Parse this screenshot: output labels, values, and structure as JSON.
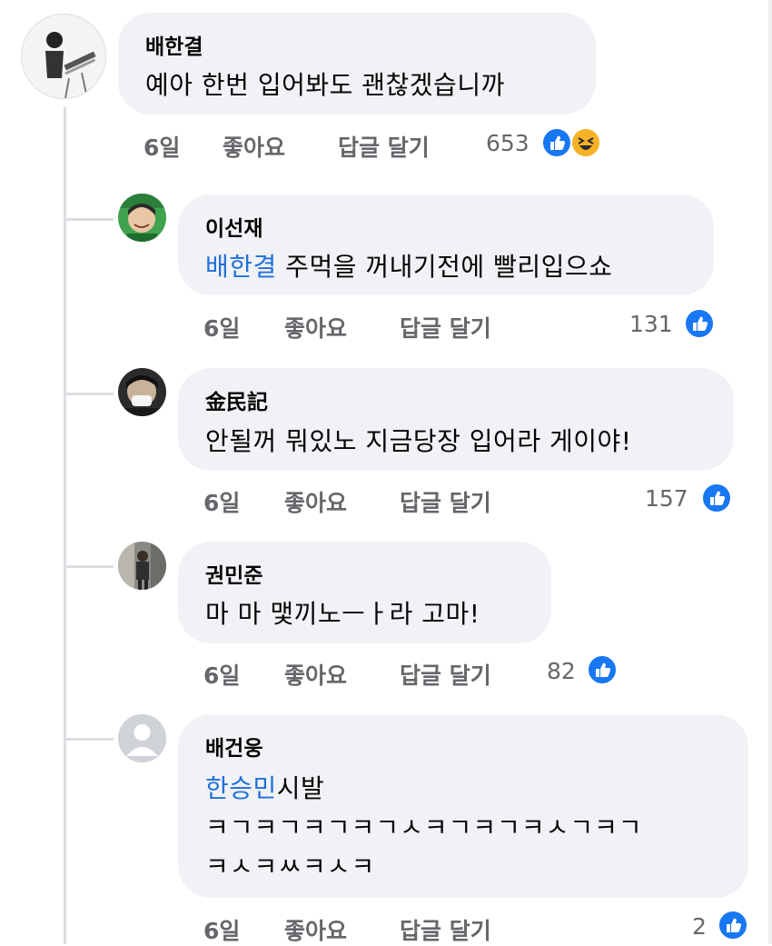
{
  "comments": [
    {
      "author": "배한결",
      "text": "예아 한번 입어봐도 괜찮겠습니까",
      "time": "6일",
      "like": "좋아요",
      "reply": "답글 달기",
      "reactions": "653",
      "reaction_icons": [
        "like-icon",
        "haha-icon"
      ]
    },
    {
      "author": "이선재",
      "mention": "배한결",
      "text": " 주먹을 꺼내기전에 빨리입으쇼",
      "time": "6일",
      "like": "좋아요",
      "reply": "답글 달기",
      "reactions": "131",
      "reaction_icons": [
        "like-icon"
      ]
    },
    {
      "author": "金民記",
      "text": "안될꺼 뭐있노 지금당장 입어라 게이야!",
      "time": "6일",
      "like": "좋아요",
      "reply": "답글 달기",
      "reactions": "157",
      "reaction_icons": [
        "like-icon"
      ]
    },
    {
      "author": "권민준",
      "text": "마 마 맻끼노ㅡㅏ라 고마!",
      "time": "6일",
      "like": "좋아요",
      "reply": "답글 달기",
      "reactions": "82",
      "reaction_icons": [
        "like-icon"
      ]
    },
    {
      "author": "배건웅",
      "mention": "한승민",
      "text": "시발",
      "text_line2": "ㅋㄱㅋㄱㅋㄱㅋㄱㅅㅋㄱㅋㄱㅋㅅㄱㅋㄱ",
      "text_line3": "ㅋㅅㅋㅆㅋㅅㅋ",
      "time": "6일",
      "like": "좋아요",
      "reply": "답글 달기",
      "reactions": "2",
      "reaction_icons": [
        "like-icon"
      ]
    }
  ],
  "colors": {
    "bubble": "#f0f2f5",
    "mention": "#216fdb",
    "meta": "#65676b",
    "like": "#1877f2",
    "haha": "#f7b125"
  }
}
